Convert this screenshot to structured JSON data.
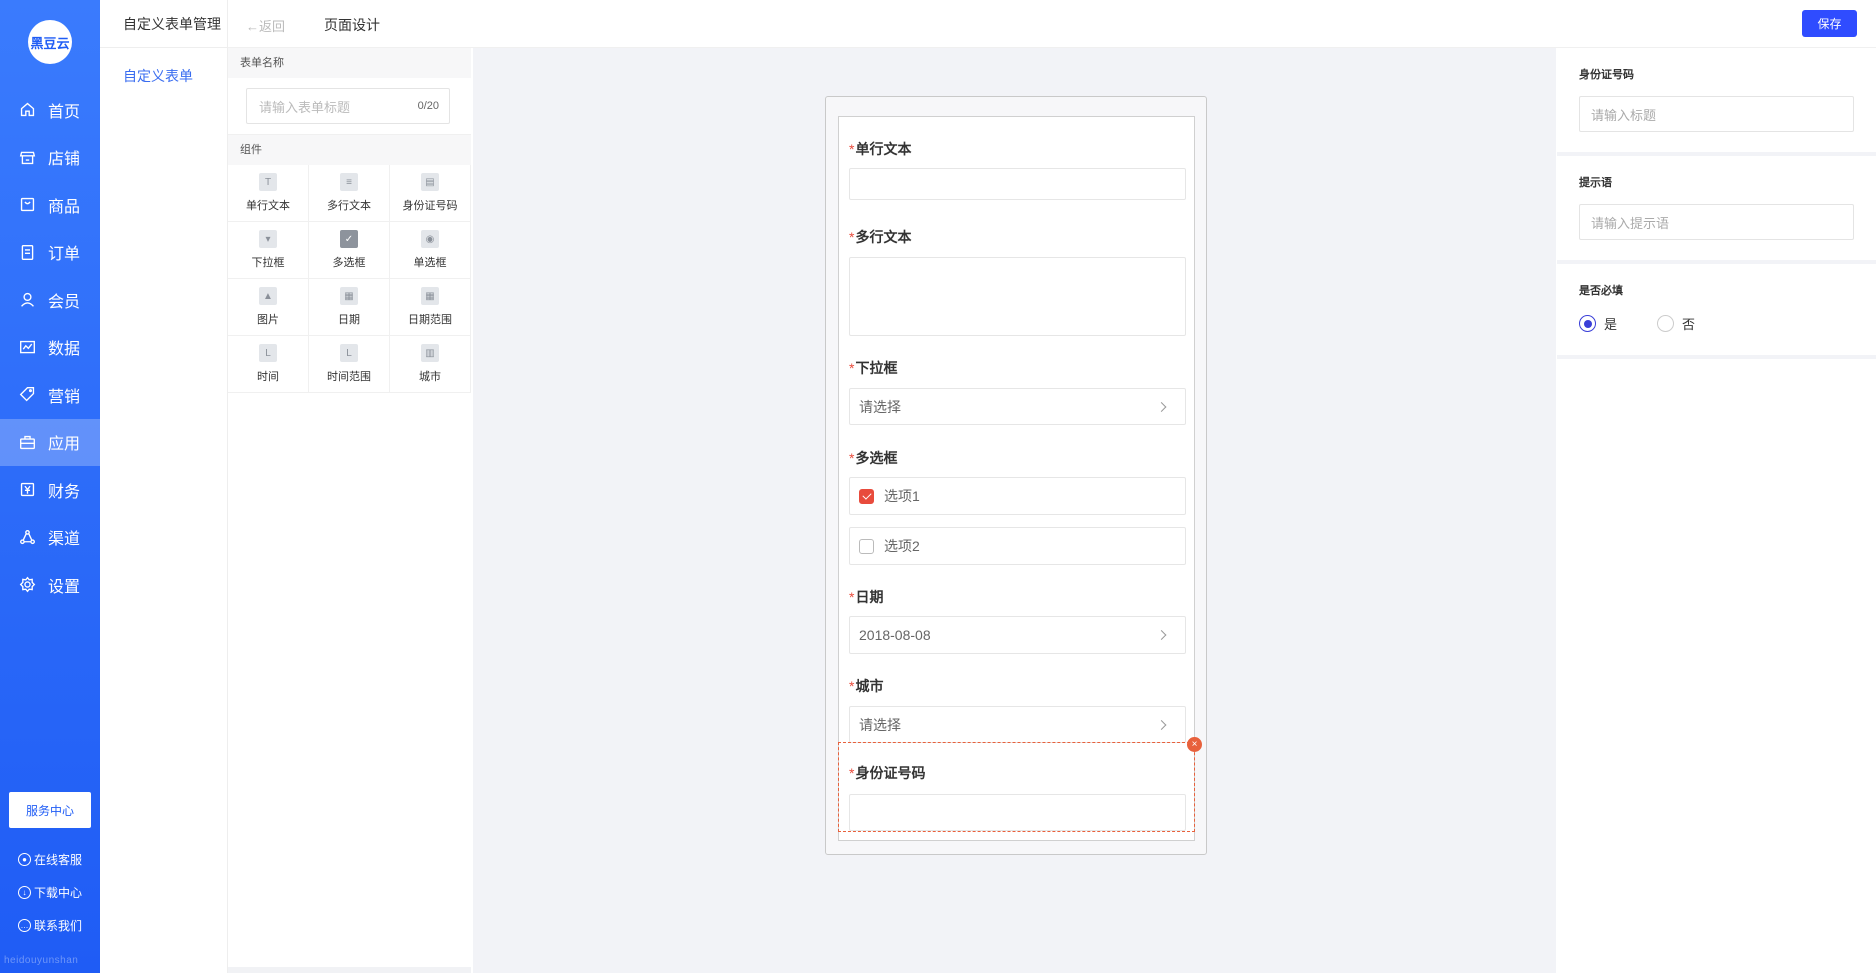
{
  "brand": {
    "logo_text": "黑豆云",
    "watermark": "heidouyunshan"
  },
  "sidebar": {
    "items": [
      {
        "label": "首页",
        "icon": "home-icon"
      },
      {
        "label": "店铺",
        "icon": "store-icon"
      },
      {
        "label": "商品",
        "icon": "goods-icon"
      },
      {
        "label": "订单",
        "icon": "order-icon"
      },
      {
        "label": "会员",
        "icon": "member-icon"
      },
      {
        "label": "数据",
        "icon": "data-icon"
      },
      {
        "label": "营销",
        "icon": "tag-icon"
      },
      {
        "label": "应用",
        "icon": "app-icon",
        "active": true
      },
      {
        "label": "财务",
        "icon": "finance-icon"
      },
      {
        "label": "渠道",
        "icon": "channel-icon"
      },
      {
        "label": "设置",
        "icon": "settings-icon"
      }
    ],
    "service_button": "服务中心",
    "links": [
      "在线客服",
      "下载中心",
      "联系我们"
    ]
  },
  "subside": {
    "title": "自定义表单管理",
    "item": "自定义表单"
  },
  "header": {
    "back_label": "返回",
    "title": "页面设计",
    "save_label": "保存"
  },
  "panel": {
    "form_name_label": "表单名称",
    "form_name_placeholder": "请输入表单标题",
    "form_name_count": "0/20",
    "components_label": "组件",
    "components": [
      "单行文本",
      "多行文本",
      "身份证号码",
      "下拉框",
      "多选框",
      "单选框",
      "图片",
      "日期",
      "日期范围",
      "时间",
      "时间范围",
      "城市"
    ]
  },
  "preview": {
    "required_mark": "*",
    "fields": {
      "single_text": "单行文本",
      "multi_text": "多行文本",
      "dropdown": "下拉框",
      "dropdown_value": "请选择",
      "checkbox": "多选框",
      "option1": "选项1",
      "option2": "选项2",
      "date": "日期",
      "date_value": "2018-08-08",
      "city": "城市",
      "city_value": "请选择",
      "id_card": "身份证号码"
    },
    "delete_symbol": "×"
  },
  "props": {
    "title_label": "身份证号码",
    "title_placeholder": "请输入标题",
    "hint_label": "提示语",
    "hint_placeholder": "请输入提示语",
    "required_label": "是否必填",
    "yes": "是",
    "no": "否",
    "required_value": "是"
  },
  "colors": {
    "primary": "#2f4cff",
    "sidebar": "#1f5cf5",
    "required": "#e84b3c",
    "selected_border": "#e8613c"
  }
}
